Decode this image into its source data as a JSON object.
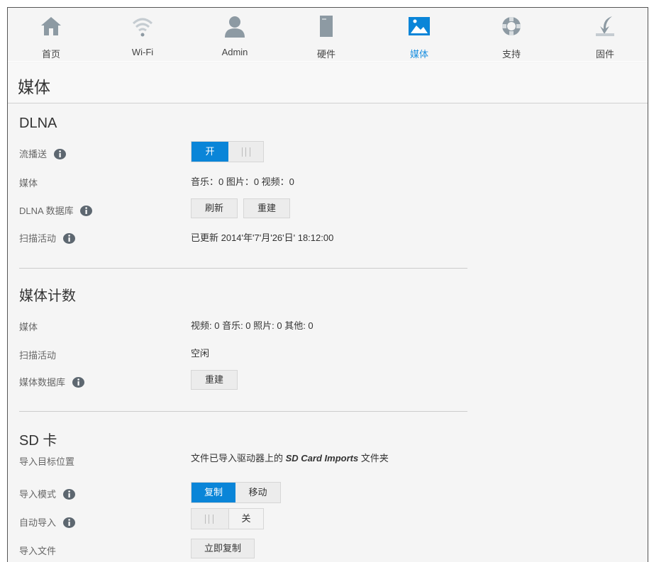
{
  "nav": {
    "items": [
      {
        "label": "首页",
        "icon": "home-icon"
      },
      {
        "label": "Wi-Fi",
        "icon": "wifi-icon"
      },
      {
        "label": "Admin",
        "icon": "user-icon"
      },
      {
        "label": "硬件",
        "icon": "drive-icon"
      },
      {
        "label": "媒体",
        "icon": "media-icon",
        "active": true
      },
      {
        "label": "支持",
        "icon": "lifebuoy-icon"
      },
      {
        "label": "固件",
        "icon": "firmware-icon"
      }
    ]
  },
  "colors": {
    "accent": "#0a85d8",
    "active_label": "#1a8fe0"
  },
  "page_title": "媒体",
  "dlna": {
    "title": "DLNA",
    "streaming_label": "流播送",
    "streaming_on": "开",
    "media_label": "媒体",
    "media_value": "音乐：0   图片：0   视频：0",
    "db_label": "DLNA 数据库",
    "refresh_btn": "刷新",
    "rebuild_btn": "重建",
    "scan_label": "扫描活动",
    "scan_value": "已更新 2014'年'7'月'26'日' 18:12:00"
  },
  "counts": {
    "title": "媒体计数",
    "media_label": "媒体",
    "media_value": "视频: 0   音乐: 0   照片: 0   其他: 0",
    "scan_label": "扫描活动",
    "scan_value": "空闲",
    "db_label": "媒体数据库",
    "rebuild_btn": "重建"
  },
  "sd": {
    "title": "SD 卡",
    "target_label": "导入目标位置",
    "target_prefix": "文件已导入驱动器上的 ",
    "target_folder": "SD Card Imports",
    "target_suffix": " 文件夹",
    "mode_label": "导入模式",
    "mode_copy": "复制",
    "mode_move": "移动",
    "auto_label": "自动导入",
    "auto_off": "关",
    "files_label": "导入文件",
    "copy_now_btn": "立即复制"
  }
}
